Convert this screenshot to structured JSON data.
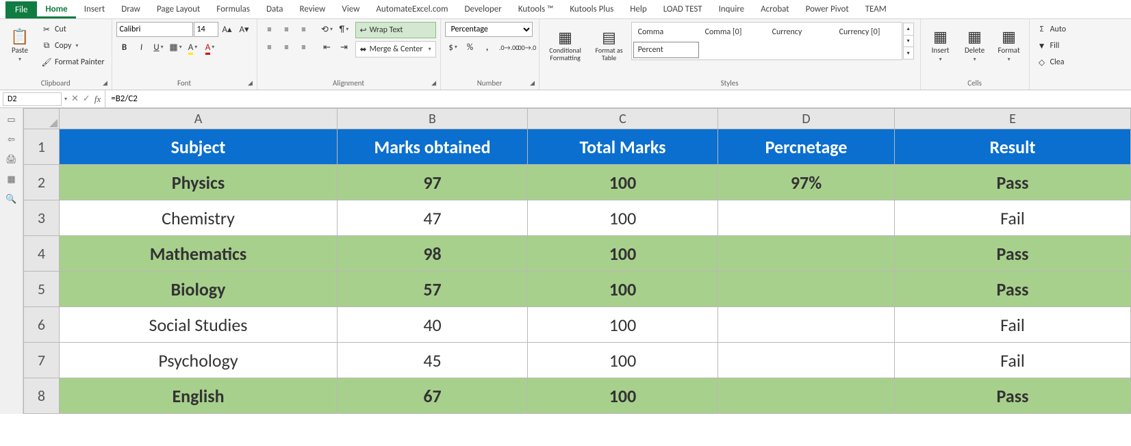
{
  "tabs": [
    "File",
    "Home",
    "Insert",
    "Draw",
    "Page Layout",
    "Formulas",
    "Data",
    "Review",
    "View",
    "AutomateExcel.com",
    "Developer",
    "Kutools ™",
    "Kutools Plus",
    "Help",
    "LOAD TEST",
    "Inquire",
    "Acrobat",
    "Power Pivot",
    "TEAM"
  ],
  "active_tab": "Home",
  "clipboard": {
    "paste": "Paste",
    "cut": "Cut",
    "copy": "Copy",
    "painter": "Format Painter",
    "label": "Clipboard"
  },
  "font": {
    "name": "Calibri",
    "size": "14",
    "label": "Font"
  },
  "alignment": {
    "wrap": "Wrap Text",
    "merge": "Merge & Center",
    "label": "Alignment"
  },
  "number": {
    "format": "Percentage",
    "label": "Number"
  },
  "formatting": {
    "conditional": "Conditional Formatting",
    "table": "Format as Table"
  },
  "styles": {
    "items": [
      "Comma",
      "Comma [0]",
      "Currency",
      "Currency [0]",
      "Percent"
    ],
    "selected": "Percent",
    "label": "Styles"
  },
  "cells": {
    "insert": "Insert",
    "delete": "Delete",
    "format": "Format",
    "label": "Cells"
  },
  "editing": {
    "autosum": "Auto",
    "fill": "Fill",
    "clear": "Clea"
  },
  "name_box": "D2",
  "formula": "=B2/C2",
  "columns": [
    "A",
    "B",
    "C",
    "D",
    "E"
  ],
  "rows": [
    {
      "n": "1",
      "type": "header",
      "cells": [
        "Subject",
        "Marks obtained",
        "Total Marks",
        "Percnetage",
        "Result"
      ]
    },
    {
      "n": "2",
      "type": "pass",
      "cells": [
        "Physics",
        "97",
        "100",
        "97%",
        "Pass"
      ]
    },
    {
      "n": "3",
      "type": "fail",
      "cells": [
        "Chemistry",
        "47",
        "100",
        "",
        "Fail"
      ]
    },
    {
      "n": "4",
      "type": "pass",
      "cells": [
        "Mathematics",
        "98",
        "100",
        "",
        "Pass"
      ]
    },
    {
      "n": "5",
      "type": "pass",
      "cells": [
        "Biology",
        "57",
        "100",
        "",
        "Pass"
      ]
    },
    {
      "n": "6",
      "type": "fail",
      "cells": [
        "Social Studies",
        "40",
        "100",
        "",
        "Fail"
      ]
    },
    {
      "n": "7",
      "type": "fail",
      "cells": [
        "Psychology",
        "45",
        "100",
        "",
        "Fail"
      ]
    },
    {
      "n": "8",
      "type": "pass",
      "cells": [
        "English",
        "67",
        "100",
        "",
        "Pass"
      ]
    }
  ]
}
